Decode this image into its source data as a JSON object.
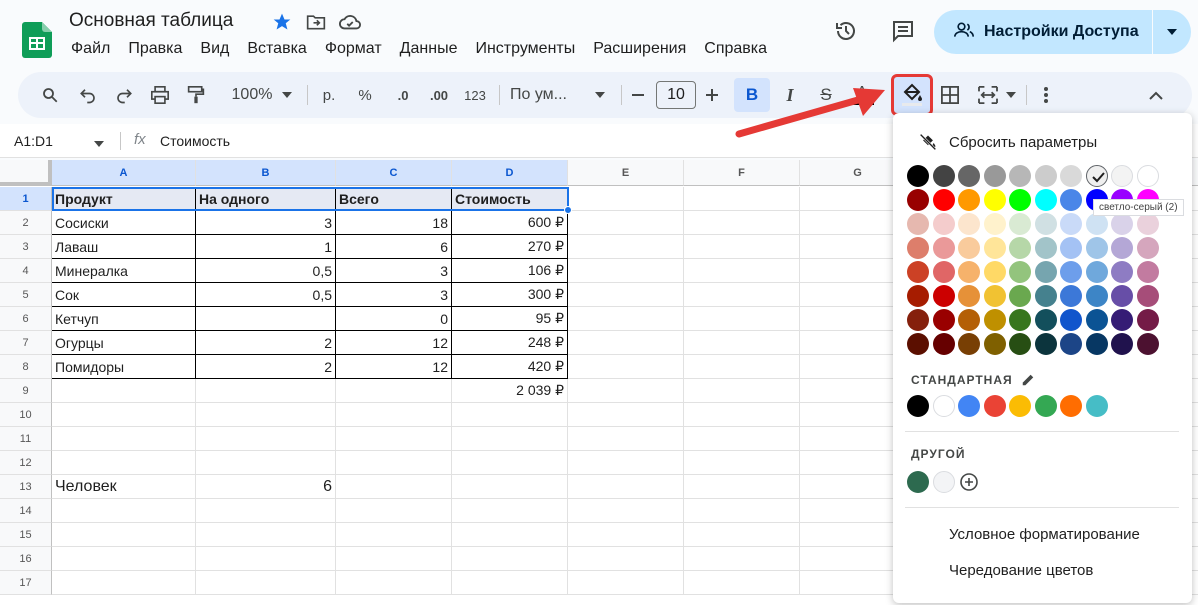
{
  "doc": {
    "title": "Основная таблица"
  },
  "menu": [
    "Файл",
    "Правка",
    "Вид",
    "Вставка",
    "Формат",
    "Данные",
    "Инструменты",
    "Расширения",
    "Справка"
  ],
  "share": {
    "label": "Настройки Доступа"
  },
  "toolbar": {
    "zoom": "100%",
    "currency": "р.",
    "percent": "%",
    "dec_minus": ".0",
    "dec_plus": ".00",
    "format_123": "123",
    "font": "По ум...",
    "font_size": "10",
    "bold": "B",
    "italic": "I",
    "strike": "S",
    "text_color": "A"
  },
  "formula": {
    "namebox": "A1:D1",
    "fx": "fx",
    "content": "Стоимость"
  },
  "columns": [
    "A",
    "B",
    "C",
    "D",
    "E",
    "F",
    "G"
  ],
  "rows": [
    "1",
    "2",
    "3",
    "4",
    "5",
    "6",
    "7",
    "8",
    "9",
    "10",
    "11",
    "12",
    "13",
    "14",
    "15",
    "16",
    "17"
  ],
  "table": {
    "headers": [
      "Продукт",
      "На одного",
      "Всего",
      "Стоимость"
    ],
    "data": [
      [
        "Сосиски",
        "3",
        "18",
        "600 ₽"
      ],
      [
        "Лаваш",
        "1",
        "6",
        "270 ₽"
      ],
      [
        "Минералка",
        "0,5",
        "3",
        "106 ₽"
      ],
      [
        "Сок",
        "0,5",
        "3",
        "300 ₽"
      ],
      [
        "Кетчуп",
        "",
        "0",
        "95 ₽"
      ],
      [
        "Огурцы",
        "2",
        "12",
        "248 ₽"
      ],
      [
        "Помидоры",
        "2",
        "12",
        "420 ₽"
      ]
    ],
    "total": "2 039 ₽",
    "people_label": "Человек",
    "people_value": "6"
  },
  "color_menu": {
    "reset": "Сбросить параметры",
    "tooltip": "светло-серый (2)",
    "standard_label": "СТАНДАРТНАЯ",
    "custom_label": "ДРУГОЙ",
    "conditional": "Условное форматирование",
    "alternating": "Чередование цветов",
    "palette": [
      [
        "#000000",
        "#434343",
        "#666666",
        "#999999",
        "#b7b7b7",
        "#cccccc",
        "#d9d9d9",
        "#efefef",
        "#f3f3f3",
        "#ffffff"
      ],
      [
        "#980000",
        "#ff0000",
        "#ff9900",
        "#ffff00",
        "#00ff00",
        "#00ffff",
        "#4a86e8",
        "#0000ff",
        "#9900ff",
        "#ff00ff"
      ],
      [
        "#e6b8af",
        "#f4cccc",
        "#fce5cd",
        "#fff2cc",
        "#d9ead3",
        "#d0e0e3",
        "#c9daf8",
        "#cfe2f3",
        "#d9d2e9",
        "#ead1dc"
      ],
      [
        "#dd7e6b",
        "#ea9999",
        "#f9cb9c",
        "#ffe599",
        "#b6d7a8",
        "#a2c4c9",
        "#a4c2f4",
        "#9fc5e8",
        "#b4a7d6",
        "#d5a6bd"
      ],
      [
        "#cc4125",
        "#e06666",
        "#f6b26b",
        "#ffd966",
        "#93c47d",
        "#76a5af",
        "#6d9eeb",
        "#6fa8dc",
        "#8e7cc3",
        "#c27ba0"
      ],
      [
        "#a61c00",
        "#cc0000",
        "#e69138",
        "#f1c232",
        "#6aa84f",
        "#45818e",
        "#3c78d8",
        "#3d85c6",
        "#674ea7",
        "#a64d79"
      ],
      [
        "#85200c",
        "#990000",
        "#b45f06",
        "#bf9000",
        "#38761d",
        "#134f5c",
        "#1155cc",
        "#0b5394",
        "#351c75",
        "#741b47"
      ],
      [
        "#5b0f00",
        "#660000",
        "#783f04",
        "#7f6000",
        "#274e13",
        "#0c343d",
        "#1c4587",
        "#073763",
        "#20124d",
        "#4c1130"
      ]
    ],
    "standard": [
      "#000000",
      "#ffffff",
      "#4285f4",
      "#ea4335",
      "#fbbc04",
      "#34a853",
      "#ff6d01",
      "#46bdc6"
    ],
    "custom": [
      "#2d6a4f",
      "#f3f4f6"
    ]
  }
}
